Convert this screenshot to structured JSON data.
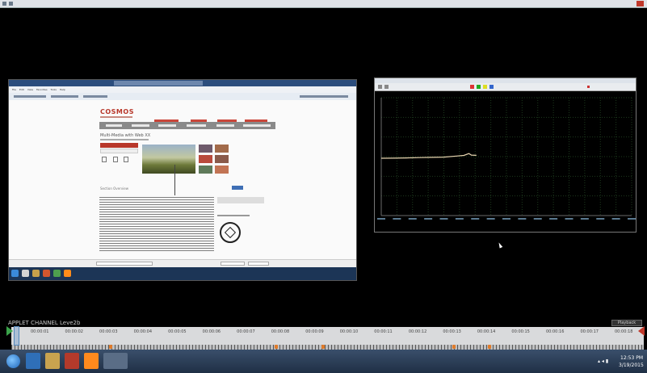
{
  "left_window": {
    "site_logo": "COSMOS",
    "page_heading": "Multi-Media with Web XX",
    "section_title": "Section Overview",
    "address_placeholder": ""
  },
  "right_window": {
    "plot_series": "trace",
    "chart_data": {
      "type": "line",
      "x": [
        0,
        5,
        10,
        15,
        20,
        25,
        30,
        33,
        35,
        36,
        38
      ],
      "values": [
        48.6,
        48.7,
        48.9,
        49.2,
        49.4,
        49.6,
        50.5,
        51.0,
        52.6,
        51.3,
        51.1
      ],
      "ylim": [
        0,
        100
      ],
      "xlim": [
        0,
        100
      ],
      "grid": true,
      "line_color": "#e8d5b0",
      "title": "",
      "xlabel": "",
      "ylabel": ""
    }
  },
  "timeline": {
    "label": "APPLET CHANNEL   Leve2b",
    "right_button": "Playback",
    "times": [
      "00:00:01",
      "00:00:02",
      "00:00:03",
      "00:00:04",
      "00:00:05",
      "00:00:06",
      "00:00:07",
      "00:00:08",
      "00:00:09",
      "00:00:10",
      "00:00:11",
      "00:00:12",
      "00:00:13",
      "00:00:14",
      "00:00:15",
      "00:00:16",
      "00:00:17",
      "00:00:18"
    ]
  },
  "taskbar": {
    "clock_time": "12:53 PM",
    "clock_date": "3/19/2015",
    "colors": {
      "accent": "#1d64b8"
    }
  }
}
